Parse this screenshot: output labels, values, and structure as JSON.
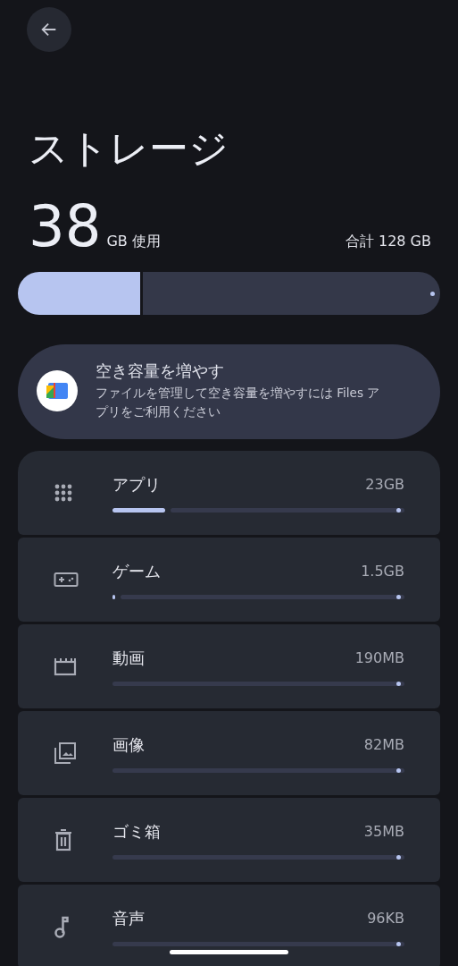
{
  "title": "ストレージ",
  "usage": {
    "used": "38",
    "used_unit": "GB 使用",
    "total": "合計 128 GB",
    "level": 0.29
  },
  "promo": {
    "title": "空き容量を増やす",
    "text": "ファイルを管理して空き容量を増やすには Files アプリをご利用ください"
  },
  "categories": [
    {
      "kind": "apps",
      "label": "アプリ",
      "size": "23GB",
      "level": 0.18
    },
    {
      "kind": "games",
      "label": "ゲーム",
      "size": "1.5GB",
      "level": 0.01
    },
    {
      "kind": "video",
      "label": "動画",
      "size": "190MB",
      "level": 0
    },
    {
      "kind": "images",
      "label": "画像",
      "size": "82MB",
      "level": 0
    },
    {
      "kind": "trash",
      "label": "ゴミ箱",
      "size": "35MB",
      "level": 0
    },
    {
      "kind": "audio",
      "label": "音声",
      "size": "96KB",
      "level": 0
    }
  ]
}
